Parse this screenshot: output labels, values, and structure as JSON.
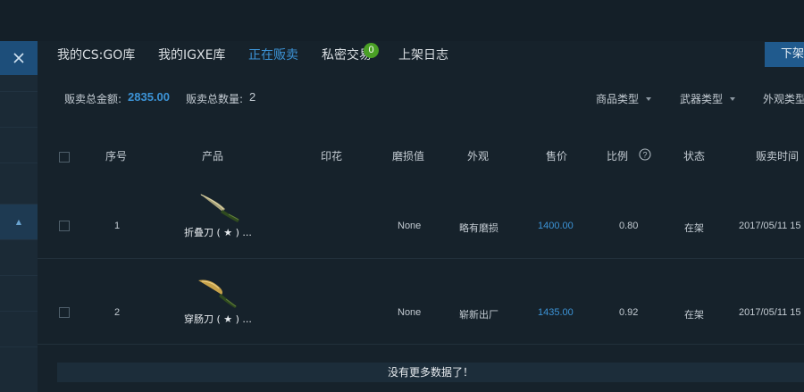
{
  "tabs": [
    {
      "label": "我的CS:GO库"
    },
    {
      "label": "我的IGXE库"
    },
    {
      "label": "正在贩卖",
      "active": true
    },
    {
      "label": "私密交易",
      "badge": "0"
    },
    {
      "label": "上架日志"
    }
  ],
  "actions": {
    "offshelf_label": "下架"
  },
  "summary": {
    "total_amount_label": "贩卖总金额:",
    "total_amount_value": "2835.00",
    "total_count_label": "贩卖总数量:",
    "total_count_value": "2"
  },
  "filters": [
    {
      "label": "商品类型"
    },
    {
      "label": "武器类型"
    },
    {
      "label": "外观类型"
    }
  ],
  "table": {
    "columns": [
      "序号",
      "产品",
      "印花",
      "磨损值",
      "外观",
      "售价",
      "比例",
      "状态",
      "贩卖时间"
    ],
    "rows": [
      {
        "index": "1",
        "product": "折叠刀 ( ★ ) ...",
        "sticker": "",
        "wear": "None",
        "exterior": "略有磨损",
        "price": "1400.00",
        "ratio": "0.80",
        "status": "在架",
        "time": "2017/05/11 15"
      },
      {
        "index": "2",
        "product": "穿肠刀 ( ★ ) ...",
        "sticker": "",
        "wear": "None",
        "exterior": "崭新出厂",
        "price": "1435.00",
        "ratio": "0.92",
        "status": "在架",
        "time": "2017/05/11 15"
      }
    ]
  },
  "footer": {
    "no_more": "没有更多数据了！"
  },
  "colors": {
    "accent": "#3c93d6",
    "badge": "#4aa025",
    "button": "#205a8d"
  },
  "icons": {
    "close": "close-icon",
    "help": "help-circle-icon",
    "dropdown": "caret-down-icon",
    "sidebar_active": "caret-up-icon"
  }
}
